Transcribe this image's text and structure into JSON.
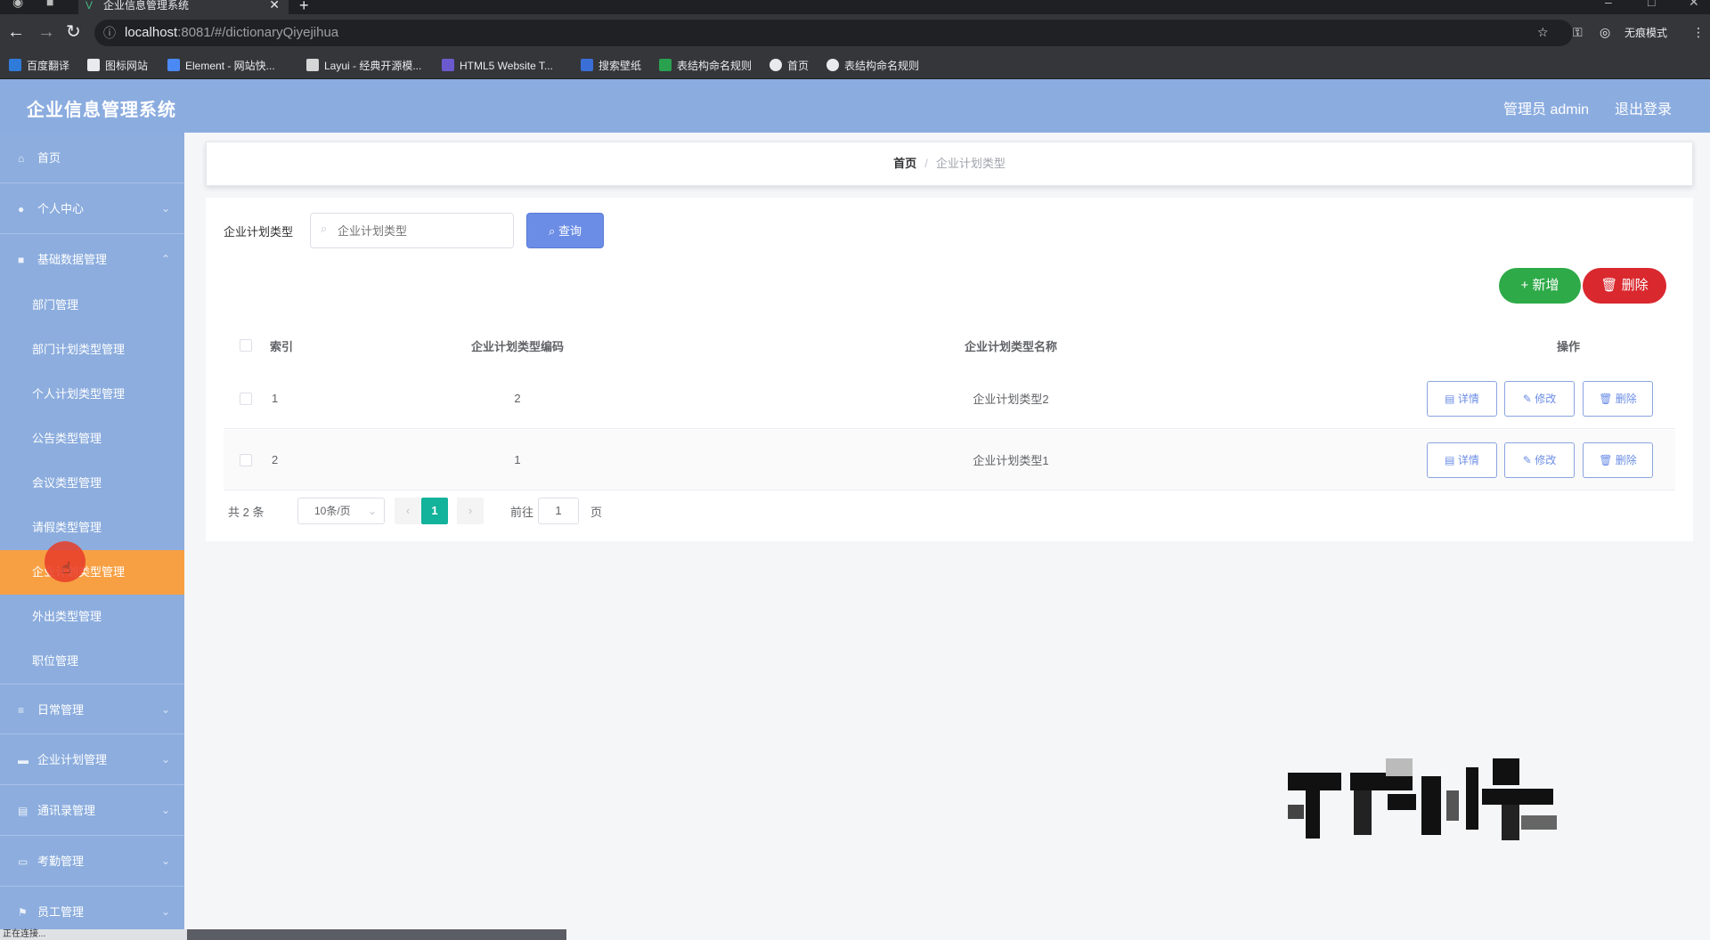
{
  "browser": {
    "tab_title": "企业信息管理系统",
    "url_host": "localhost",
    "url_path": ":8081/#/dictionaryQiyejihua",
    "profile_label": "无痕模式",
    "bookmarks": [
      "百度翻译",
      "图标网站",
      "Element - 网站快...",
      "Layui - 经典开源模...",
      "HTML5 Website T...",
      "搜索壁纸",
      "表结构命名规则",
      "首页",
      "表结构命名规则"
    ],
    "status": "正在连接..."
  },
  "header": {
    "title": "企业信息管理系统",
    "user": "管理员 admin",
    "logout": "退出登录"
  },
  "sidebar": {
    "home": "首页",
    "personal": "个人中心",
    "basic_data": "基础数据管理",
    "sub_items": [
      "部门管理",
      "部门计划类型管理",
      "个人计划类型管理",
      "公告类型管理",
      "会议类型管理",
      "请假类型管理",
      "企业计划类型管理",
      "外出类型管理",
      "职位管理"
    ],
    "daily": "日常管理",
    "enterprise_plan": "企业计划管理",
    "contacts": "通讯录管理",
    "attendance": "考勤管理",
    "staff": "员工管理"
  },
  "breadcrumb": {
    "home": "首页",
    "current": "企业计划类型"
  },
  "search": {
    "label": "企业计划类型",
    "placeholder": "企业计划类型",
    "button": "查询"
  },
  "actions": {
    "add": "新增",
    "delete": "删除"
  },
  "table": {
    "headers": [
      "索引",
      "企业计划类型编码",
      "企业计划类型名称",
      "操作"
    ],
    "rows": [
      {
        "index": "1",
        "code": "2",
        "name": "企业计划类型2"
      },
      {
        "index": "2",
        "code": "1",
        "name": "企业计划类型1"
      }
    ],
    "row_actions": {
      "detail": "详情",
      "edit": "修改",
      "delete": "删除"
    }
  },
  "pagination": {
    "total": "共 2 条",
    "page_size": "10条/页",
    "current": "1",
    "goto_label": "前往",
    "goto_value": "1",
    "page_suffix": "页"
  },
  "colors": {
    "header_bg": "#8bacdf",
    "sidebar_bg": "#8cadde",
    "active_item": "#f7a043",
    "primary": "#6b8de6",
    "success": "#2eaa48",
    "danger": "#d9282e",
    "pager_active": "#13b29a"
  }
}
